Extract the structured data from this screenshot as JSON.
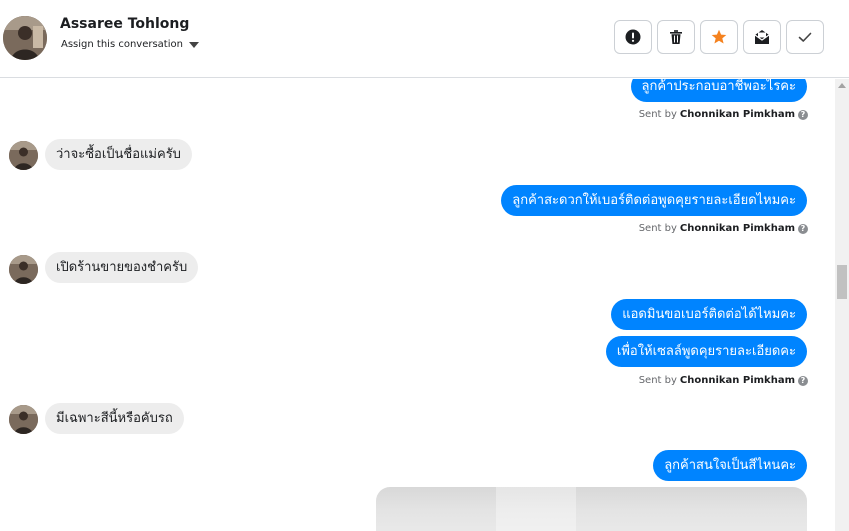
{
  "header": {
    "contact_name": "Assaree Tohlong",
    "assign_label": "Assign this conversation",
    "actions": [
      {
        "name": "mark-spam-button",
        "icon": "exclamation-circle-icon"
      },
      {
        "name": "delete-button",
        "icon": "trash-icon"
      },
      {
        "name": "star-button",
        "icon": "star-icon",
        "color": "#f5821f"
      },
      {
        "name": "mark-unread-button",
        "icon": "envelope-icon"
      },
      {
        "name": "mark-done-button",
        "icon": "check-icon"
      }
    ]
  },
  "messages": [
    {
      "dir": "out",
      "text": "ลูกค้าประกอบอาชีพอะไรคะ",
      "sent_by_prefix": "Sent by",
      "sent_by": "Chonnikan Pimkham"
    },
    {
      "dir": "in",
      "text": "ว่าจะซื้อเป็นชื่อแม่ครับ"
    },
    {
      "dir": "out",
      "text": "ลูกค้าสะดวกให้เบอร์ติดต่อพูดคุยรายละเอียดไหมคะ",
      "sent_by_prefix": "Sent by",
      "sent_by": "Chonnikan Pimkham"
    },
    {
      "dir": "in",
      "text": "เปิดร้านขายของชำครับ"
    },
    {
      "dir": "out",
      "text": "แอดมินขอเบอร์ติดต่อได้ไหมคะ"
    },
    {
      "dir": "out",
      "text": "เพื่อให้เซลล์พูดคุยรายละเอียดคะ",
      "sent_by_prefix": "Sent by",
      "sent_by": "Chonnikan Pimkham"
    },
    {
      "dir": "in",
      "text": "มีเฉพาะสีนี้หรือคับรถ"
    },
    {
      "dir": "out",
      "text": "ลูกค้าสนใจเป็นสีไหนคะ"
    }
  ],
  "colors": {
    "outgoing_bubble": "#0084ff",
    "incoming_bubble": "#ededed",
    "star": "#f5821f"
  }
}
